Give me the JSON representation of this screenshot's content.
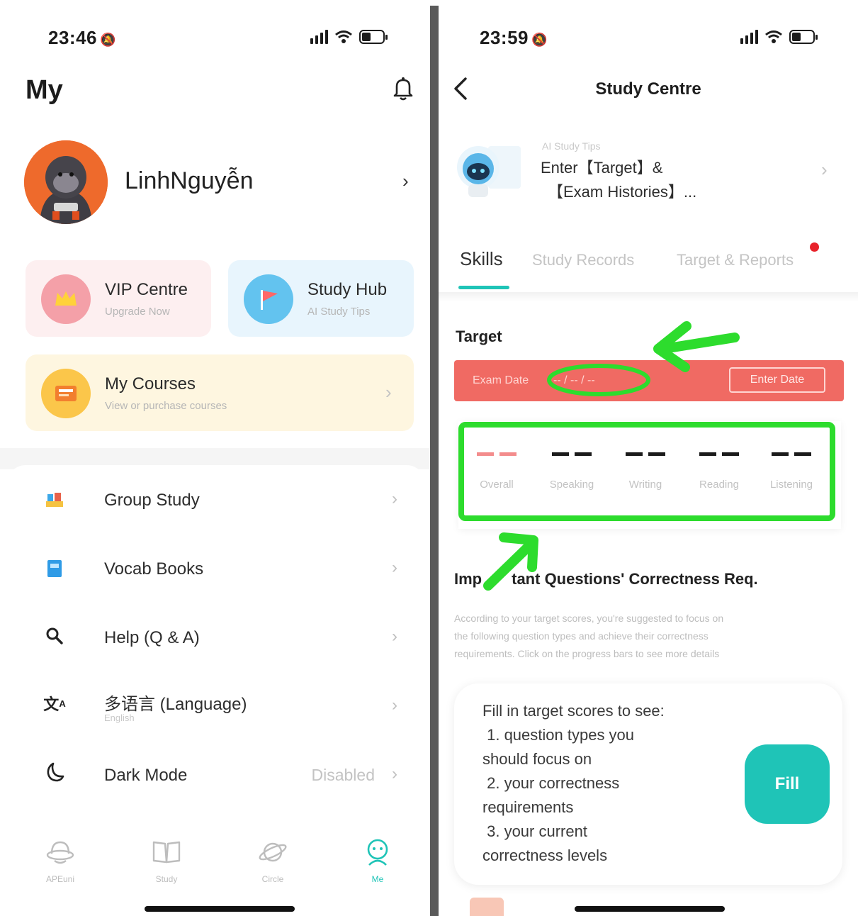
{
  "left_screen": {
    "status_bar": {
      "time": "23:46"
    },
    "header": {
      "title": "My"
    },
    "profile": {
      "name": "LinhNguyễn"
    },
    "cards": {
      "vip": {
        "title": "VIP Centre",
        "subtitle": "Upgrade Now"
      },
      "study_hub": {
        "title": "Study Hub",
        "subtitle": "AI Study Tips"
      },
      "courses": {
        "title": "My Courses",
        "subtitle": "View or purchase courses"
      }
    },
    "menu": {
      "group_study": "Group Study",
      "vocab_books": "Vocab Books",
      "help": "Help (Q & A)",
      "language": "多语言 (Language)",
      "language_value": "English",
      "dark_mode": "Dark Mode",
      "dark_mode_value": "Disabled"
    },
    "tabbar": {
      "home": "APEuni",
      "study": "Study",
      "circle": "Circle",
      "me": "Me"
    },
    "colors": {
      "accent": "#1fc4b7"
    }
  },
  "right_screen": {
    "status_bar": {
      "time": "23:59"
    },
    "nav": {
      "title": "Study Centre"
    },
    "ai_tips": {
      "label": "AI Study Tips",
      "line1": "Enter【Target】&",
      "line2": "【Exam Histories】..."
    },
    "tabs": {
      "skills": "Skills",
      "study_records": "Study Records",
      "target_reports": "Target & Reports"
    },
    "target": {
      "title": "Target",
      "exam_date_label": "Exam Date",
      "exam_date_value": "-- / -- / --",
      "enter_date": "Enter Date",
      "scores": [
        {
          "label": "Overall",
          "value": "--"
        },
        {
          "label": "Speaking",
          "value": "--"
        },
        {
          "label": "Writing",
          "value": "--"
        },
        {
          "label": "Reading",
          "value": "--"
        },
        {
          "label": "Listening",
          "value": "--"
        }
      ]
    },
    "questions": {
      "title_part1": "Imp",
      "title_part2": "tant Questions' Correctness Req.",
      "desc1": "According to your target scores, you're suggested to focus on",
      "desc2": "the following question types and achieve their correctness",
      "desc3": "requirements. Click on the progress bars to see more details"
    },
    "fill_card": {
      "line1": "Fill in target scores to see:",
      "line2": " 1. question types you",
      "line3": "should focus on",
      "line4": " 2. your correctness",
      "line5": "requirements",
      "line6": " 3. your current",
      "line7": "correctness levels",
      "button": "Fill"
    },
    "colors": {
      "exam_bar": "#f06a63",
      "highlight": "#2ddc2d",
      "tab_indicator": "#1fc4b7"
    }
  }
}
